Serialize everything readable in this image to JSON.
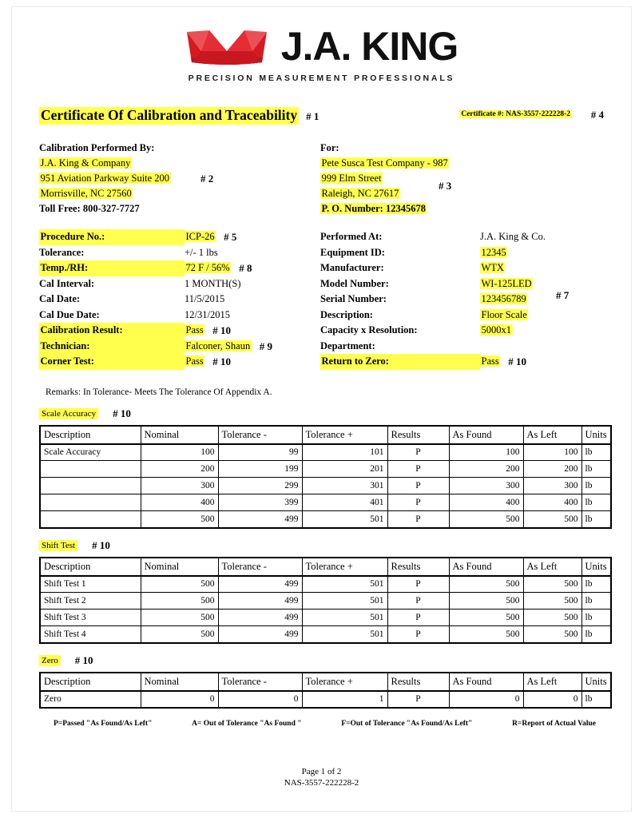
{
  "logo": {
    "icon": "crown-icon",
    "brand": "J.A. KING",
    "tagline": "PRECISION MEASUREMENT PROFESSIONALS",
    "crown_color": "#d71920"
  },
  "colors": {
    "highlight": "#ffff4d",
    "text": "#000000",
    "border": "#000000"
  },
  "header": {
    "title": "Certificate Of Calibration and Traceability",
    "title_annotation": "# 1",
    "certificate_number": "Certificate #: NAS-3557-222228-2",
    "certificate_annotation": "# 4"
  },
  "performed_by": {
    "heading": "Calibration Performed By:",
    "company": "J.A. King & Company",
    "street": "951 Aviation Parkway Suite 200",
    "city_state_zip": "Morrisville, NC 27560",
    "toll_free": "Toll Free: 800-327-7727",
    "annotation": "# 2"
  },
  "customer": {
    "heading": "For:",
    "company": "Pete Susca Test Company - 987",
    "street": "999 Elm Street",
    "city_state_zip": "Raleigh, NC 27617",
    "po_number": "P. O. Number: 12345678",
    "annotation": "# 3"
  },
  "details_left": [
    {
      "label": "Procedure No.:",
      "value": "ICP-26",
      "label_hl": true,
      "value_hl": true,
      "annotation": "# 5"
    },
    {
      "label": "Tolerance:",
      "value": "+/- 1 lbs",
      "label_hl": false,
      "value_hl": false,
      "annotation": ""
    },
    {
      "label": "Temp./RH:",
      "value": "72 F / 56%",
      "label_hl": true,
      "value_hl": true,
      "annotation": "# 8"
    },
    {
      "label": "Cal Interval:",
      "value": "1 MONTH(S)",
      "label_hl": false,
      "value_hl": false,
      "annotation": ""
    },
    {
      "label": "Cal Date:",
      "value": "11/5/2015",
      "label_hl": false,
      "value_hl": false,
      "annotation": ""
    },
    {
      "label": "Cal Due Date:",
      "value": "12/31/2015",
      "label_hl": false,
      "value_hl": false,
      "annotation": ""
    },
    {
      "label": "Calibration Result:",
      "value": "Pass",
      "label_hl": true,
      "value_hl": true,
      "annotation": "# 10"
    },
    {
      "label": "Technician:",
      "value": "Falconer, Shaun",
      "label_hl": true,
      "value_hl": true,
      "annotation": "# 9"
    },
    {
      "label": "Corner Test:",
      "value": "Pass",
      "label_hl": true,
      "value_hl": true,
      "annotation": "# 10"
    }
  ],
  "details_right": [
    {
      "label": "Performed At:",
      "value": "J.A. King & Co.",
      "label_hl": false,
      "value_hl": false,
      "annotation": ""
    },
    {
      "label": "Equipment ID:",
      "value": "12345",
      "label_hl": false,
      "value_hl": true,
      "annotation": ""
    },
    {
      "label": "Manufacturer:",
      "value": "WTX",
      "label_hl": false,
      "value_hl": true,
      "annotation": ""
    },
    {
      "label": "Model Number:",
      "value": "WI-125LED",
      "label_hl": false,
      "value_hl": true,
      "annotation": ""
    },
    {
      "label": "Serial Number:",
      "value": "123456789",
      "label_hl": false,
      "value_hl": true,
      "annotation": ""
    },
    {
      "label": "Description:",
      "value": "Floor Scale",
      "label_hl": false,
      "value_hl": true,
      "annotation": ""
    },
    {
      "label": "Capacity x Resolution:",
      "value": "5000x1",
      "label_hl": false,
      "value_hl": true,
      "annotation": ""
    },
    {
      "label": "Department:",
      "value": "",
      "label_hl": false,
      "value_hl": false,
      "annotation": ""
    },
    {
      "label": "Return to Zero:",
      "value": "Pass",
      "label_hl": true,
      "value_hl": true,
      "annotation": "# 10"
    }
  ],
  "details_right_annotation": "# 7",
  "remarks": "Remarks:  In Tolerance- Meets The Tolerance Of Appendix A.",
  "table_columns": [
    "Description",
    "Nominal",
    "Tolerance -",
    "Tolerance +",
    "Results",
    "As Found",
    "As Left",
    "Units"
  ],
  "sections": [
    {
      "name": "Scale Accuracy",
      "annotation": "# 10",
      "rows": [
        [
          "Scale Accuracy",
          "100",
          "99",
          "101",
          "P",
          "100",
          "100",
          "lb"
        ],
        [
          "",
          "200",
          "199",
          "201",
          "P",
          "200",
          "200",
          "lb"
        ],
        [
          "",
          "300",
          "299",
          "301",
          "P",
          "300",
          "300",
          "lb"
        ],
        [
          "",
          "400",
          "399",
          "401",
          "P",
          "400",
          "400",
          "lb"
        ],
        [
          "",
          "500",
          "499",
          "501",
          "P",
          "500",
          "500",
          "lb"
        ]
      ]
    },
    {
      "name": "Shift Test",
      "annotation": "# 10",
      "rows": [
        [
          "Shift Test 1",
          "500",
          "499",
          "501",
          "P",
          "500",
          "500",
          "lb"
        ],
        [
          "Shift Test 2",
          "500",
          "499",
          "501",
          "P",
          "500",
          "500",
          "lb"
        ],
        [
          "Shift Test 3",
          "500",
          "499",
          "501",
          "P",
          "500",
          "500",
          "lb"
        ],
        [
          "Shift Test 4",
          "500",
          "499",
          "501",
          "P",
          "500",
          "500",
          "lb"
        ]
      ]
    },
    {
      "name": "Zero",
      "annotation": "# 10",
      "rows": [
        [
          "Zero",
          "0",
          "0",
          "1",
          "P",
          "0",
          "0",
          "lb"
        ]
      ]
    }
  ],
  "legend": [
    "P=Passed \"As Found/As Left\"",
    "A= Out of Tolerance \"As Found \"",
    "F=Out of Tolerance \"As Found/As Left\"",
    "R=Report of Actual Value"
  ],
  "footer": {
    "page": "Page 1 of 2",
    "document_number": "NAS-3557-222228-2"
  }
}
